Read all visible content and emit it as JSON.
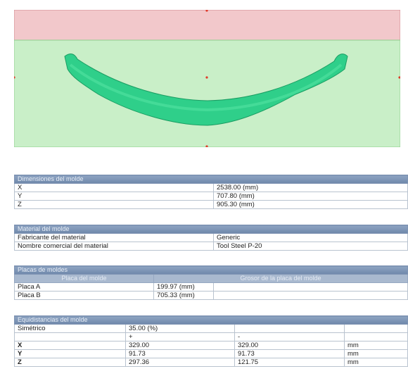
{
  "colors": {
    "top_plate": "#f2c8cb",
    "bottom_plate": "#c9efc8",
    "part": "#2fcf8a",
    "header": "#7f97b8"
  },
  "dimensiones": {
    "title": "Dimensiones del molde",
    "rows": [
      {
        "label": "X",
        "value": "2538.00 (mm)"
      },
      {
        "label": "Y",
        "value": "707.80 (mm)"
      },
      {
        "label": "Z",
        "value": "905.30 (mm)"
      }
    ]
  },
  "material": {
    "title": "Material del molde",
    "rows": [
      {
        "label": "Fabricante del material",
        "value": "Generic"
      },
      {
        "label": "Nombre comercial del material",
        "value": "Tool Steel P-20"
      }
    ]
  },
  "placas": {
    "title": "Placas de moldes",
    "col1": "Placa del molde",
    "col2": "Grosor de la placa del molde",
    "rows": [
      {
        "label": "Placa A",
        "value": "199.97 (mm)"
      },
      {
        "label": "Placa B",
        "value": "705.33 (mm)"
      }
    ]
  },
  "equidistancias": {
    "title": "Equidistancias del molde",
    "sim_label": "Simétrico",
    "sim_value": "35.00 (%)",
    "plus": "+",
    "minus": "-",
    "rows": [
      {
        "label": "X",
        "plus": "329.00",
        "minus": "329.00",
        "unit": "mm"
      },
      {
        "label": "Y",
        "plus": "91.73",
        "minus": "91.73",
        "unit": "mm"
      },
      {
        "label": "Z",
        "plus": "297.36",
        "minus": "121.75",
        "unit": "mm"
      }
    ]
  }
}
